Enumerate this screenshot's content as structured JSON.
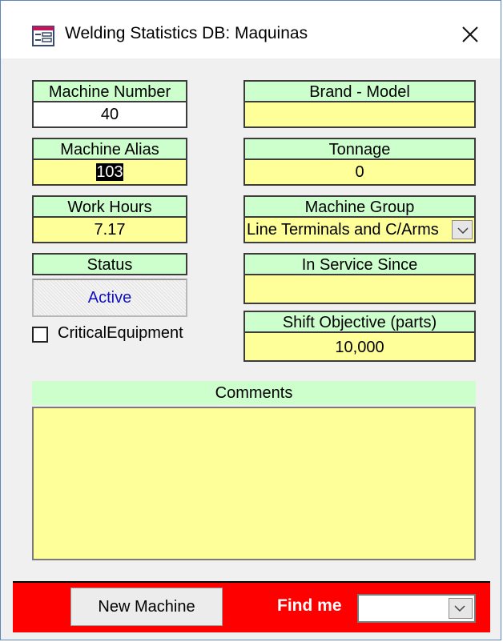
{
  "window": {
    "title": "Welding Statistics DB: Maquinas",
    "icons": {
      "app": "form-icon",
      "close": "close-icon"
    }
  },
  "fields": {
    "machine_number": {
      "label": "Machine Number",
      "value": "40"
    },
    "machine_alias": {
      "label": "Machine Alias",
      "value": "103",
      "selected_text": "103"
    },
    "work_hours": {
      "label": "Work Hours",
      "value": "7.17"
    },
    "status": {
      "label": "Status",
      "value": "Active"
    },
    "critical_equipment": {
      "label": "CriticalEquipment",
      "checked": false
    },
    "brand_model": {
      "label": "Brand - Model",
      "value": ""
    },
    "tonnage": {
      "label": "Tonnage",
      "value": "0"
    },
    "machine_group": {
      "label": "Machine Group",
      "value": "Line Terminals and C/Arms"
    },
    "in_service_since": {
      "label": "In Service Since",
      "value": ""
    },
    "shift_objective": {
      "label": "Shift Objective (parts)",
      "value": "10,000"
    },
    "comments": {
      "label": "Comments",
      "value": ""
    }
  },
  "footer": {
    "new_machine_label": "New Machine",
    "find_label": "Find me",
    "find_value": ""
  },
  "colors": {
    "label_bg": "#ccffcc",
    "field_bg": "#ffff99",
    "footer_bg": "#ff0000",
    "status_text": "#1010c0"
  }
}
